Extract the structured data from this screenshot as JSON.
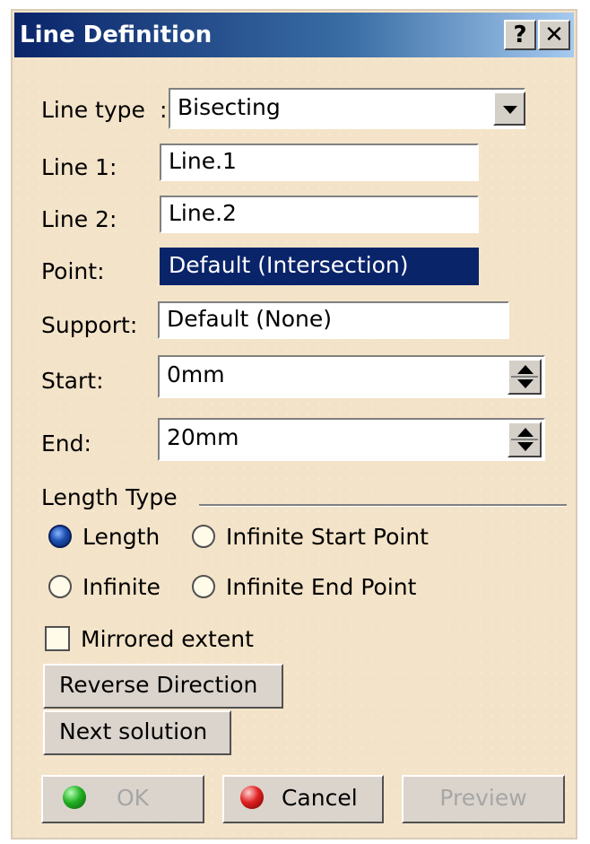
{
  "window": {
    "title": "Line Definition",
    "help_label": "?",
    "close_label": "✕"
  },
  "form": {
    "line_type_label": "Line type",
    "line_type_colon": ":",
    "line_type_value": "Bisecting",
    "line1_label": "Line 1:",
    "line1_value": "Line.1",
    "line2_label": "Line 2:",
    "line2_value": "Line.2",
    "point_label": "Point:",
    "point_value": "Default (Intersection)",
    "support_label": "Support:",
    "support_value": "Default (None)",
    "start_label": "Start:",
    "start_value": "0mm",
    "end_label": "End:",
    "end_value": "20mm"
  },
  "length_type": {
    "group_label": "Length Type",
    "options": [
      {
        "label": "Length",
        "selected": true
      },
      {
        "label": "Infinite Start Point",
        "selected": false
      },
      {
        "label": "Infinite",
        "selected": false
      },
      {
        "label": "Infinite End Point",
        "selected": false
      }
    ]
  },
  "mirrored": {
    "label": "Mirrored extent",
    "checked": false
  },
  "buttons": {
    "reverse_direction": "Reverse Direction",
    "next_solution": "Next solution",
    "ok": "OK",
    "cancel": "Cancel",
    "preview": "Preview"
  },
  "icons": {
    "ok": "green-ball-icon",
    "cancel": "red-ball-icon",
    "dropdown": "chevron-down-icon",
    "spinner": "spinner-arrows-icon"
  }
}
